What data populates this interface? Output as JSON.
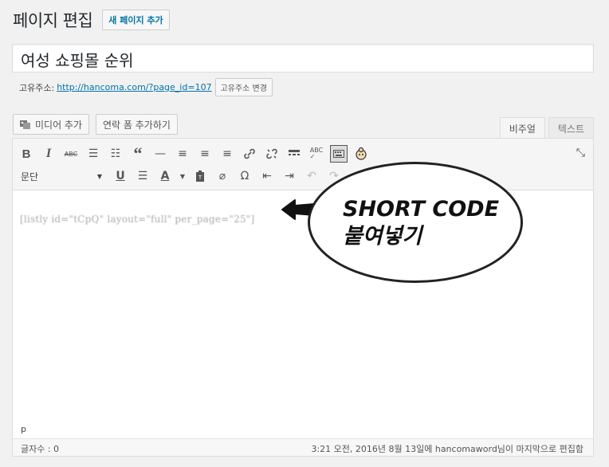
{
  "header": {
    "title": "페이지 편집",
    "add_new": "새 페이지 추가"
  },
  "post_title": "여성 쇼핑몰 순위",
  "permalink": {
    "label": "고유주소:",
    "url": "http://hancoma.com/?page_id=107",
    "edit_button": "고유주소 변경"
  },
  "media": {
    "add_media": "미디어 추가",
    "add_form": "연락 폼 추가하기"
  },
  "tabs": {
    "visual": "비주얼",
    "text": "텍스트"
  },
  "toolbar": {
    "row1_icons": [
      "bold-icon",
      "italic-icon",
      "strikethrough-icon",
      "bullet-list-icon",
      "numbered-list-icon",
      "blockquote-icon",
      "horizontal-line-icon",
      "align-left-icon",
      "align-center-icon",
      "align-right-icon",
      "link-icon",
      "unlink-icon",
      "read-more-icon",
      "spellcheck-icon",
      "toolbar-toggle-icon",
      "plugin-icon"
    ],
    "format_select": "문단",
    "row2_icons": [
      "underline-icon",
      "justify-icon",
      "text-color-icon",
      "paste-text-icon",
      "clear-format-icon",
      "special-char-icon",
      "outdent-icon",
      "indent-icon",
      "undo-icon",
      "redo-icon"
    ]
  },
  "content": {
    "shortcode": "[listly id=\"tCpQ\" layout=\"full\" per_page=\"25\"]"
  },
  "annotation": {
    "line1": "SHORT CODE",
    "line2": "붙여넣기"
  },
  "status": {
    "path": "p",
    "word_count": "글자수 : 0",
    "last_edit": "3:21 오전, 2016년 8월 13일에 hancomaword님이 마지막으로 편집함"
  },
  "colors": {
    "link": "#0073aa",
    "background": "#f1f1f1"
  }
}
